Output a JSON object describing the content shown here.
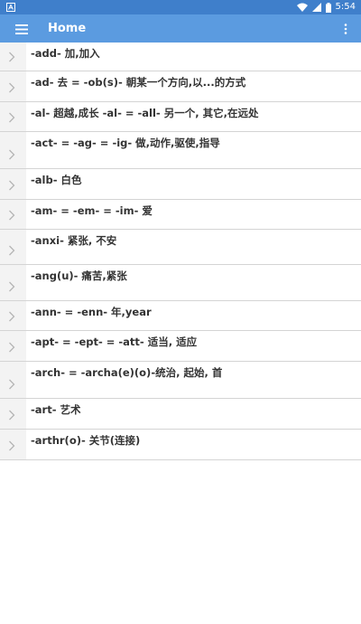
{
  "status_bar": {
    "time": "5:54",
    "icons": [
      "notification-icon",
      "wifi-icon",
      "signal-icon",
      "battery-icon"
    ]
  },
  "app_bar": {
    "title": "Home",
    "menu_icon": "hamburger-menu-icon",
    "overflow_icon": "more-vert-icon"
  },
  "colors": {
    "status_bar": "#3f7fcb",
    "app_bar": "#5b9be0",
    "item_text": "#333333",
    "divider": "#d4d4d4",
    "chevron_column": "#f3f3f3"
  },
  "list": {
    "items": [
      {
        "label": "-add- 加,加入"
      },
      {
        "label": "-ad- 去 = -ob(s)- 朝某一个方向,以...的方式"
      },
      {
        "label": "-al- 超越,成长 -al- = -all- 另一个, 其它,在远处"
      },
      {
        "label": "-act- = -ag- = -ig- 做,动作,驱使,指导"
      },
      {
        "label": "-alb- 白色"
      },
      {
        "label": "-am- = -em- = -im- 爱"
      },
      {
        "label": "-anxi- 紧张, 不安"
      },
      {
        "label": "-ang(u)- 痛苦,紧张"
      },
      {
        "label": "-ann- = -enn- 年,year"
      },
      {
        "label": "-apt- = -ept- = -att- 适当, 适应"
      },
      {
        "label": "-arch- = -archa(e)(o)-统治, 起始, 首"
      },
      {
        "label": "-art- 艺术"
      },
      {
        "label": "-arthr(o)- 关节(连接)"
      }
    ]
  }
}
